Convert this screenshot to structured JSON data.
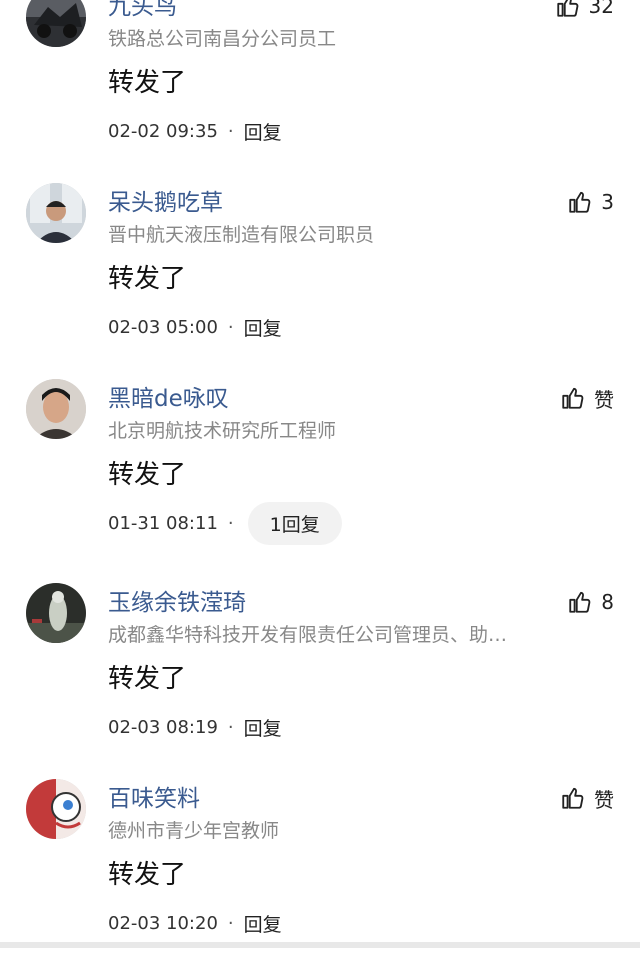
{
  "comments": [
    {
      "name": "九头鸟",
      "title": "铁路总公司南昌分公司员工",
      "text": "转发了",
      "time": "02-02 09:35",
      "reply": "回复",
      "likes": "32"
    },
    {
      "name": "呆头鹅吃草",
      "title": "晋中航天液压制造有限公司职员",
      "text": "转发了",
      "time": "02-03 05:00",
      "reply": "回复",
      "likes": "3"
    },
    {
      "name": "黑暗de咏叹",
      "title": "北京明航技术研究所工程师",
      "text": "转发了",
      "time": "01-31 08:11",
      "reply": "1回复",
      "likes": "赞"
    },
    {
      "name": "玉缘余铁滢琦",
      "title": "成都鑫华特科技开发有限责任公司管理员、助…",
      "text": "转发了",
      "time": "02-03 08:19",
      "reply": "回复",
      "likes": "8"
    },
    {
      "name": "百味笑料",
      "title": "德州市青少年宫教师",
      "text": "转发了",
      "time": "02-03 10:20",
      "reply": "回复",
      "likes": "赞"
    }
  ],
  "separator": "·"
}
